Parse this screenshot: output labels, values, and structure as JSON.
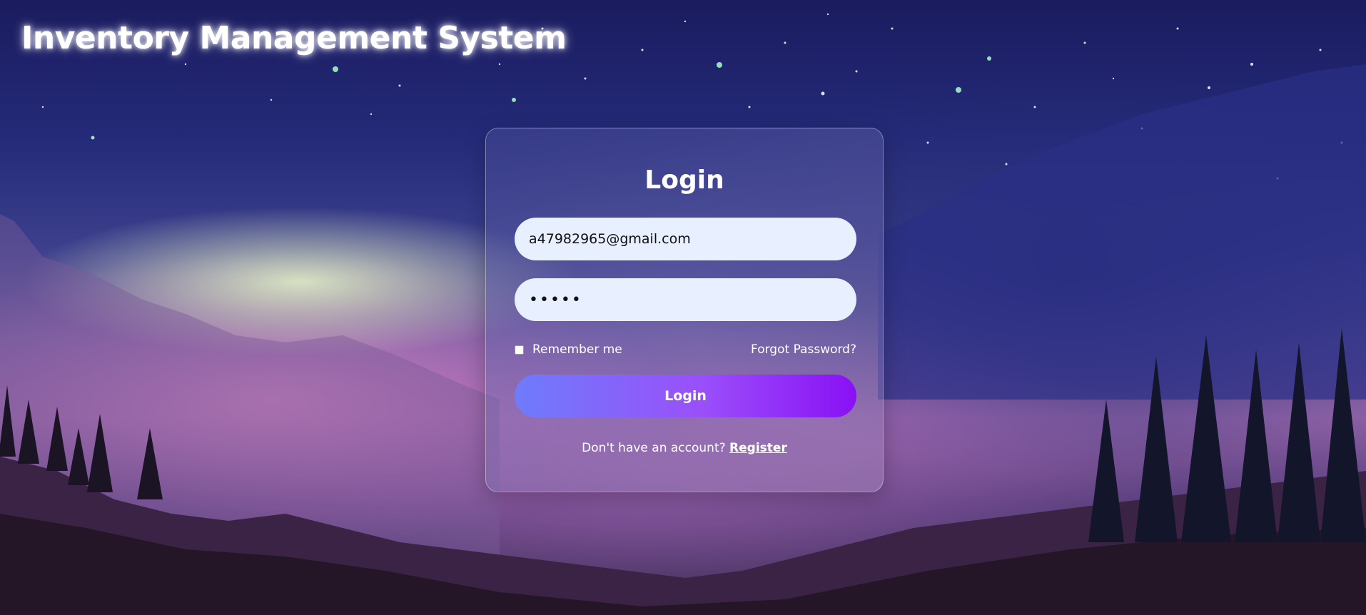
{
  "app": {
    "title": "Inventory Management System"
  },
  "login": {
    "heading": "Login",
    "email_value": "a47982965@gmail.com",
    "password_masked": "•••••",
    "remember_label": "Remember me",
    "remember_checked": false,
    "forgot_label": "Forgot Password?",
    "submit_label": "Login",
    "no_account_text": "Don't have an account?",
    "register_label": "Register"
  },
  "colors": {
    "button_gradient_start": "#6e7cfb",
    "button_gradient_end": "#8a10f5",
    "input_background": "#e8effe",
    "text": "#ffffff"
  }
}
